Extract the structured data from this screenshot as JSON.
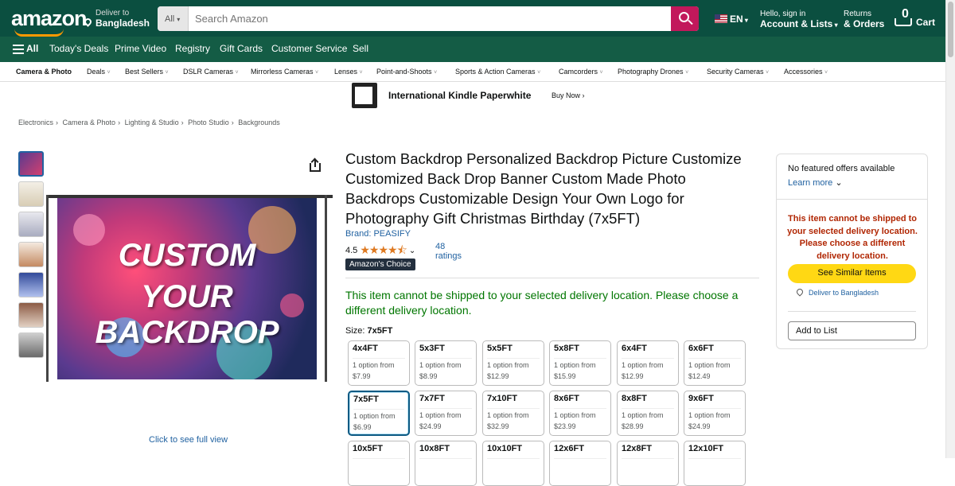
{
  "header": {
    "logo": "amazon",
    "deliver_line1": "Deliver to",
    "deliver_line2": "Bangladesh",
    "search_category": "All",
    "search_placeholder": "Search Amazon",
    "language": "EN",
    "account_line1": "Hello, sign in",
    "account_line2": "Account & Lists",
    "returns_line1": "Returns",
    "returns_line2": "& Orders",
    "cart_count": "0",
    "cart_label": "Cart"
  },
  "nav": {
    "all": "All",
    "items": [
      "Today's Deals",
      "Prime Video",
      "Registry",
      "Gift Cards",
      "Customer Service",
      "Sell"
    ]
  },
  "subnav": {
    "items": [
      "Camera & Photo",
      "Deals",
      "Best Sellers",
      "DSLR Cameras",
      "Mirrorless Cameras",
      "Lenses",
      "Point-and-Shoots",
      "Sports & Action Cameras",
      "Camcorders",
      "Photography Drones",
      "Security Cameras",
      "Accessories"
    ]
  },
  "ad": {
    "text": "International Kindle Paperwhite",
    "cta": "Buy Now ›"
  },
  "breadcrumb": [
    "Electronics",
    "Camera & Photo",
    "Lighting & Studio",
    "Photo Studio",
    "Backgrounds"
  ],
  "gallery": {
    "image_line1": "CUSTOM",
    "image_line2": "YOUR BACKDROP",
    "full_view": "Click to see full view"
  },
  "product": {
    "title": "Custom Backdrop Personalized Backdrop Picture Customize Customized Back Drop Banner Custom Made Photo Backdrops Customizable Design Your Own Logo for Photography Gift Christmas Birthday (7x5FT)",
    "brand": "Brand: PEASIFY",
    "rating": "4.5",
    "ratings_count": "48 ratings",
    "badge": "Amazon's Choice",
    "ship_message": "This item cannot be shipped to your selected delivery location. Please choose a different delivery location.",
    "size_label": "Size:",
    "size_selected": "7x5FT",
    "sizes": [
      {
        "name": "4x4FT",
        "desc": "1 option from",
        "price": "$7.99"
      },
      {
        "name": "5x3FT",
        "desc": "1 option from",
        "price": "$8.99"
      },
      {
        "name": "5x5FT",
        "desc": "1 option from",
        "price": "$12.99"
      },
      {
        "name": "5x8FT",
        "desc": "1 option from",
        "price": "$15.99"
      },
      {
        "name": "6x4FT",
        "desc": "1 option from",
        "price": "$12.99"
      },
      {
        "name": "6x6FT",
        "desc": "1 option from",
        "price": "$12.49"
      },
      {
        "name": "7x5FT",
        "desc": "1 option from",
        "price": "$6.99"
      },
      {
        "name": "7x7FT",
        "desc": "1 option from",
        "price": "$24.99"
      },
      {
        "name": "7x10FT",
        "desc": "1 option from",
        "price": "$32.99"
      },
      {
        "name": "8x6FT",
        "desc": "1 option from",
        "price": "$23.99"
      },
      {
        "name": "8x8FT",
        "desc": "1 option from",
        "price": "$28.99"
      },
      {
        "name": "9x6FT",
        "desc": "1 option from",
        "price": "$24.99"
      },
      {
        "name": "10x5FT",
        "desc": "",
        "price": ""
      },
      {
        "name": "10x8FT",
        "desc": "",
        "price": ""
      },
      {
        "name": "10x10FT",
        "desc": "",
        "price": ""
      },
      {
        "name": "12x6FT",
        "desc": "",
        "price": ""
      },
      {
        "name": "12x8FT",
        "desc": "",
        "price": ""
      },
      {
        "name": "12x10FT",
        "desc": "",
        "price": ""
      }
    ]
  },
  "buybox": {
    "no_offers": "No featured offers available",
    "learn_more": "Learn more",
    "warning": "This item cannot be shipped to your selected delivery location. Please choose a different delivery location.",
    "see_similar": "See Similar Items",
    "deliver_to": "Deliver to Bangladesh",
    "add_to_list": "Add to List"
  },
  "colors": {
    "header_bg": "#0b4f40",
    "nav_bg": "#145c45",
    "search_button": "#c2185b",
    "link": "#2162a1",
    "success": "#007600",
    "warning": "#b12704",
    "button_yellow": "#ffd814"
  }
}
